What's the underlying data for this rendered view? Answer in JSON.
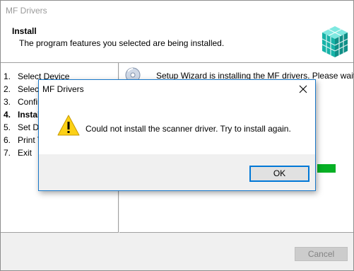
{
  "window": {
    "title": "MF Drivers",
    "header_title": "Install",
    "header_subtitle": "The program features you selected are being installed.",
    "logo_icon": "cube-logo-icon"
  },
  "steps": [
    {
      "num": "1.",
      "label": "Select Device",
      "current": false
    },
    {
      "num": "2.",
      "label": "Select",
      "current": false
    },
    {
      "num": "3.",
      "label": "Confir",
      "current": false
    },
    {
      "num": "4.",
      "label": "Instal",
      "current": true
    },
    {
      "num": "5.",
      "label": "Set De",
      "current": false
    },
    {
      "num": "6.",
      "label": "Print T",
      "current": false
    },
    {
      "num": "7.",
      "label": "Exit",
      "current": false
    }
  ],
  "content": {
    "wizard_text": "Setup Wizard is installing the MF drivers. Please wait...",
    "wizard_icon": "installer-disc-icon",
    "progress_color": "#06b025"
  },
  "footer": {
    "cancel_label": "Cancel"
  },
  "dialog": {
    "title": "MF Drivers",
    "message": "Could not install the scanner driver. Try to install again.",
    "ok_label": "OK",
    "icon": "warning-icon",
    "close_icon": "close-icon"
  },
  "colors": {
    "accent": "#0078d7",
    "warning": "#fcd116"
  }
}
